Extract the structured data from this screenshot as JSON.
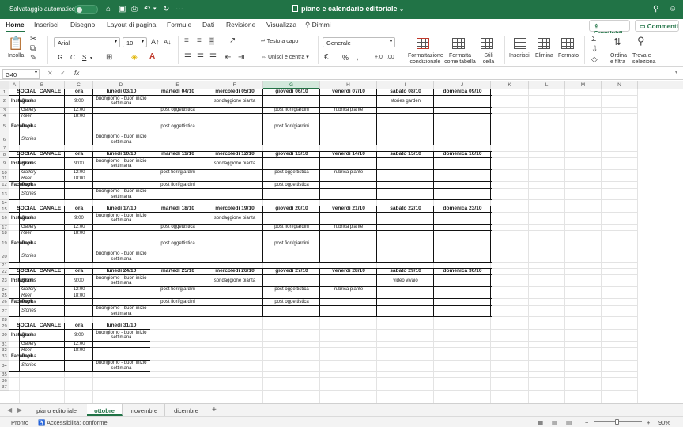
{
  "titlebar": {
    "autosave_label": "Salvataggio automatico",
    "autosave_state": "off",
    "document_title": "piano e calendario editoriale"
  },
  "ribbon_tabs": [
    "Home",
    "Inserisci",
    "Disegno",
    "Layout di pagina",
    "Formule",
    "Dati",
    "Revisione",
    "Visualizza",
    "Dimmi"
  ],
  "active_tab": "Home",
  "share_label": "Condividi",
  "comments_label": "Commenti",
  "ribbon": {
    "paste": "Incolla",
    "font_name": "Arial",
    "font_size": "10",
    "bold": "G",
    "italic": "C",
    "underline": "S",
    "wrap_text": "Testo a capo",
    "merge_center": "Unisci e centra",
    "number_format": "Generale",
    "percent": "%",
    "conditional_formatting": [
      "Formattazione",
      "condizionale"
    ],
    "format_as_table": [
      "Formatta",
      "come tabella"
    ],
    "cell_styles": [
      "Stili",
      "cella"
    ],
    "insert": "Inserisci",
    "delete": "Elimina",
    "format": "Formato",
    "sort_filter": [
      "Ordina",
      "e filtra"
    ],
    "find_select": [
      "Trova e",
      "seleziona"
    ]
  },
  "formula_bar": {
    "name_box": "G40",
    "fx": "fx",
    "value": ""
  },
  "columns": [
    "A",
    "B",
    "C",
    "D",
    "E",
    "F",
    "G",
    "H",
    "I",
    "J",
    "K",
    "L",
    "M",
    "N"
  ],
  "selected_column": "G",
  "rows": [
    "1",
    "2",
    "3",
    "4",
    "5",
    "6",
    "7",
    "8",
    "9",
    "10",
    "11",
    "12",
    "13",
    "14",
    "15",
    "16",
    "17",
    "18",
    "19",
    "20",
    "21",
    "22",
    "23",
    "24",
    "25",
    "26",
    "27",
    "28",
    "29",
    "30",
    "31",
    "32",
    "33",
    "34",
    "35",
    "36",
    "37"
  ],
  "table_header": {
    "social": "SOCIAL",
    "canale": "CANALE",
    "ora": "ora"
  },
  "weeks": [
    {
      "days": [
        "lunedì 03/10",
        "martedì 04/10",
        "mercoledì 05/10",
        "giovedì 06/10",
        "venerdì 07/10",
        "sabato 08/10",
        "domenica 09/10"
      ],
      "instagram": {
        "stories": [
          "buongiorno - buon inizio settimana",
          "",
          "sondaggione pianta",
          "",
          "",
          "stories garden",
          ""
        ],
        "gallery": [
          "",
          "post oggettistica",
          "",
          "post fiori/giardini",
          "rubrica piante",
          "",
          ""
        ],
        "reel": [
          "",
          "",
          "",
          "",
          "",
          "",
          ""
        ]
      },
      "facebook": {
        "pagina": [
          "",
          "post oggettistica",
          "",
          "post fiori/giardini",
          "",
          "",
          ""
        ],
        "stories": [
          "buongiorno - buon inizio settimana",
          "",
          "",
          "",
          "",
          "",
          ""
        ]
      }
    },
    {
      "days": [
        "lunedì 10/10",
        "martedì 11/10",
        "mercoledì 12/10",
        "giovedì 13/10",
        "venerdì 14/10",
        "sabato 15/10",
        "domenica 16/10"
      ],
      "instagram": {
        "stories": [
          "buongiorno - buon inizio settimana",
          "",
          "sondaggione pianta",
          "",
          "",
          "",
          ""
        ],
        "gallery": [
          "",
          "post fiori/giardini",
          "",
          "post oggettistica",
          "rubrica piante",
          "",
          ""
        ],
        "reel": [
          "",
          "",
          "",
          "",
          "",
          "",
          ""
        ]
      },
      "facebook": {
        "pagina": [
          "",
          "post fiori/giardini",
          "",
          "post oggettistica",
          "",
          "",
          ""
        ],
        "stories": [
          "buongiorno - buon inizio settimana",
          "",
          "",
          "",
          "",
          "",
          ""
        ]
      }
    },
    {
      "days": [
        "lunedì 17/10",
        "martedì 18/10",
        "mercoledì 19/10",
        "giovedì 20/10",
        "venerdì 21/10",
        "sabato 22/10",
        "domenica 23/10"
      ],
      "instagram": {
        "stories": [
          "buongiorno - buon inizio settimana",
          "",
          "sondaggione pianta",
          "",
          "",
          "",
          ""
        ],
        "gallery": [
          "",
          "post oggettistica",
          "",
          "post fiori/giardini",
          "rubrica piante",
          "",
          ""
        ],
        "reel": [
          "",
          "",
          "",
          "",
          "",
          "",
          ""
        ]
      },
      "facebook": {
        "pagina": [
          "",
          "post oggettistica",
          "",
          "post fiori/giardini",
          "",
          "",
          ""
        ],
        "stories": [
          "buongiorno - buon inizio settimana",
          "",
          "",
          "",
          "",
          "",
          ""
        ]
      }
    },
    {
      "days": [
        "lunedì 24/10",
        "martedì 25/10",
        "mercoledì 26/10",
        "giovedì 27/10",
        "venerdì 28/10",
        "sabato 29/10",
        "domenica 30/10"
      ],
      "instagram": {
        "stories": [
          "buongiorno - buon inizio settimana",
          "",
          "sondaggione pianta",
          "",
          "",
          "video vivaio",
          ""
        ],
        "gallery": [
          "",
          "post fiori/giardini",
          "",
          "post oggettistica",
          "rubrica piante",
          "",
          ""
        ],
        "reel": [
          "",
          "",
          "",
          "",
          "",
          "",
          ""
        ]
      },
      "facebook": {
        "pagina": [
          "",
          "post fiori/giardini",
          "",
          "post oggettistica",
          "",
          "",
          ""
        ],
        "stories": [
          "buongiorno - buon inizio settimana",
          "",
          "",
          "",
          "",
          "",
          ""
        ]
      }
    },
    {
      "days": [
        "lunedì 31/10"
      ],
      "instagram": {
        "stories": [
          "buongiorno - buon inizio settimana"
        ],
        "gallery": [
          ""
        ],
        "reel": [
          ""
        ]
      },
      "facebook": {
        "pagina": [
          ""
        ],
        "stories": [
          "buongiorno - buon inizio settimana"
        ]
      }
    }
  ],
  "labels": {
    "instagram": "Instagram",
    "facebook": "Facebook",
    "stories": "Stories",
    "gallery": "Gallery",
    "reel": "Reel",
    "pagina": "Pagina"
  },
  "times": {
    "stories": "9:00",
    "gallery": "12:00",
    "reel": "18:00"
  },
  "sheet_tabs": [
    "piano editoriale",
    "ottobre",
    "novembre",
    "dicembre"
  ],
  "active_sheet": "ottobre",
  "status": {
    "ready": "Pronto",
    "accessibility": "Accessibilità: conforme",
    "zoom": "90%"
  },
  "colors": {
    "brand_green": "#217346",
    "border_dark": "#111111",
    "gridline": "#e3e3e3"
  }
}
